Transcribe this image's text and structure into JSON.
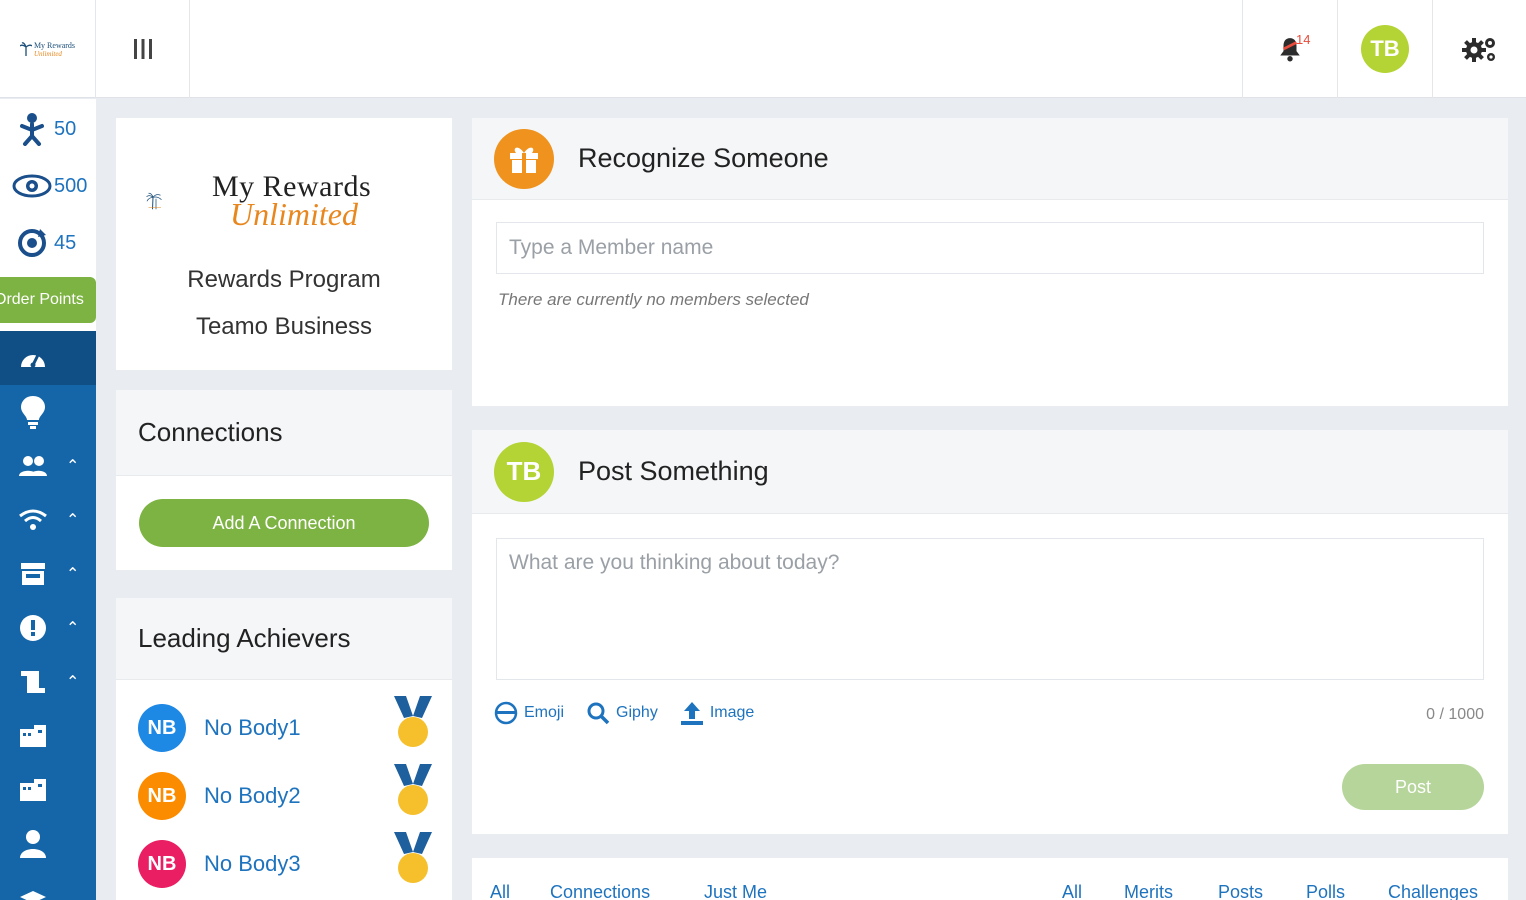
{
  "header": {
    "logo": {
      "title": "My Rewards",
      "subtitle": "Unlimited"
    },
    "notification_count": "14",
    "avatar_initials": "TB"
  },
  "sidebar": {
    "stats": [
      {
        "icon": "person-up-icon",
        "value": "50"
      },
      {
        "icon": "eye-icon",
        "value": "500"
      },
      {
        "icon": "refresh-icon",
        "value": "45"
      }
    ],
    "order_points_label": "Order Points",
    "nav": [
      {
        "icon": "dashboard-icon",
        "expandable": false
      },
      {
        "icon": "lightbulb-icon",
        "expandable": false
      },
      {
        "icon": "users-icon",
        "expandable": true
      },
      {
        "icon": "wifi-icon",
        "expandable": true
      },
      {
        "icon": "store-icon",
        "expandable": true
      },
      {
        "icon": "alert-icon",
        "expandable": true
      },
      {
        "icon": "scroll-icon",
        "expandable": true
      },
      {
        "icon": "building-icon",
        "expandable": false
      },
      {
        "icon": "building-icon",
        "expandable": false
      },
      {
        "icon": "user-icon",
        "expandable": false
      }
    ]
  },
  "brand": {
    "logo_title": "My Rewards",
    "logo_subtitle": "Unlimited",
    "program": "Rewards Program",
    "business": "Teamo Business"
  },
  "connections": {
    "title": "Connections",
    "add_button": "Add A Connection"
  },
  "leaders": {
    "title": "Leading Achievers",
    "items": [
      {
        "initials": "NB",
        "name": "No Body1",
        "color": "#1e88e5"
      },
      {
        "initials": "NB",
        "name": "No Body2",
        "color": "#fb8c00"
      },
      {
        "initials": "NB",
        "name": "No Body3",
        "color": "#e91e63"
      }
    ]
  },
  "recognize": {
    "title": "Recognize Someone",
    "placeholder": "Type a Member name",
    "empty_note": "There are currently no members selected"
  },
  "post": {
    "avatar_initials": "TB",
    "title": "Post Something",
    "placeholder": "What are you thinking about today?",
    "tools": {
      "emoji": "Emoji",
      "giphy": "Giphy",
      "image": "Image"
    },
    "counter": "0 / 1000",
    "post_button": "Post"
  },
  "filters": {
    "left": [
      "All",
      "Connections",
      "Just Me"
    ],
    "right": [
      "All",
      "Merits",
      "Posts",
      "Polls",
      "Challenges"
    ]
  },
  "colors": {
    "primary_blue": "#1566a8",
    "accent_green": "#7cb342",
    "avatar_green": "#b4d334",
    "orange": "#f0931e"
  }
}
